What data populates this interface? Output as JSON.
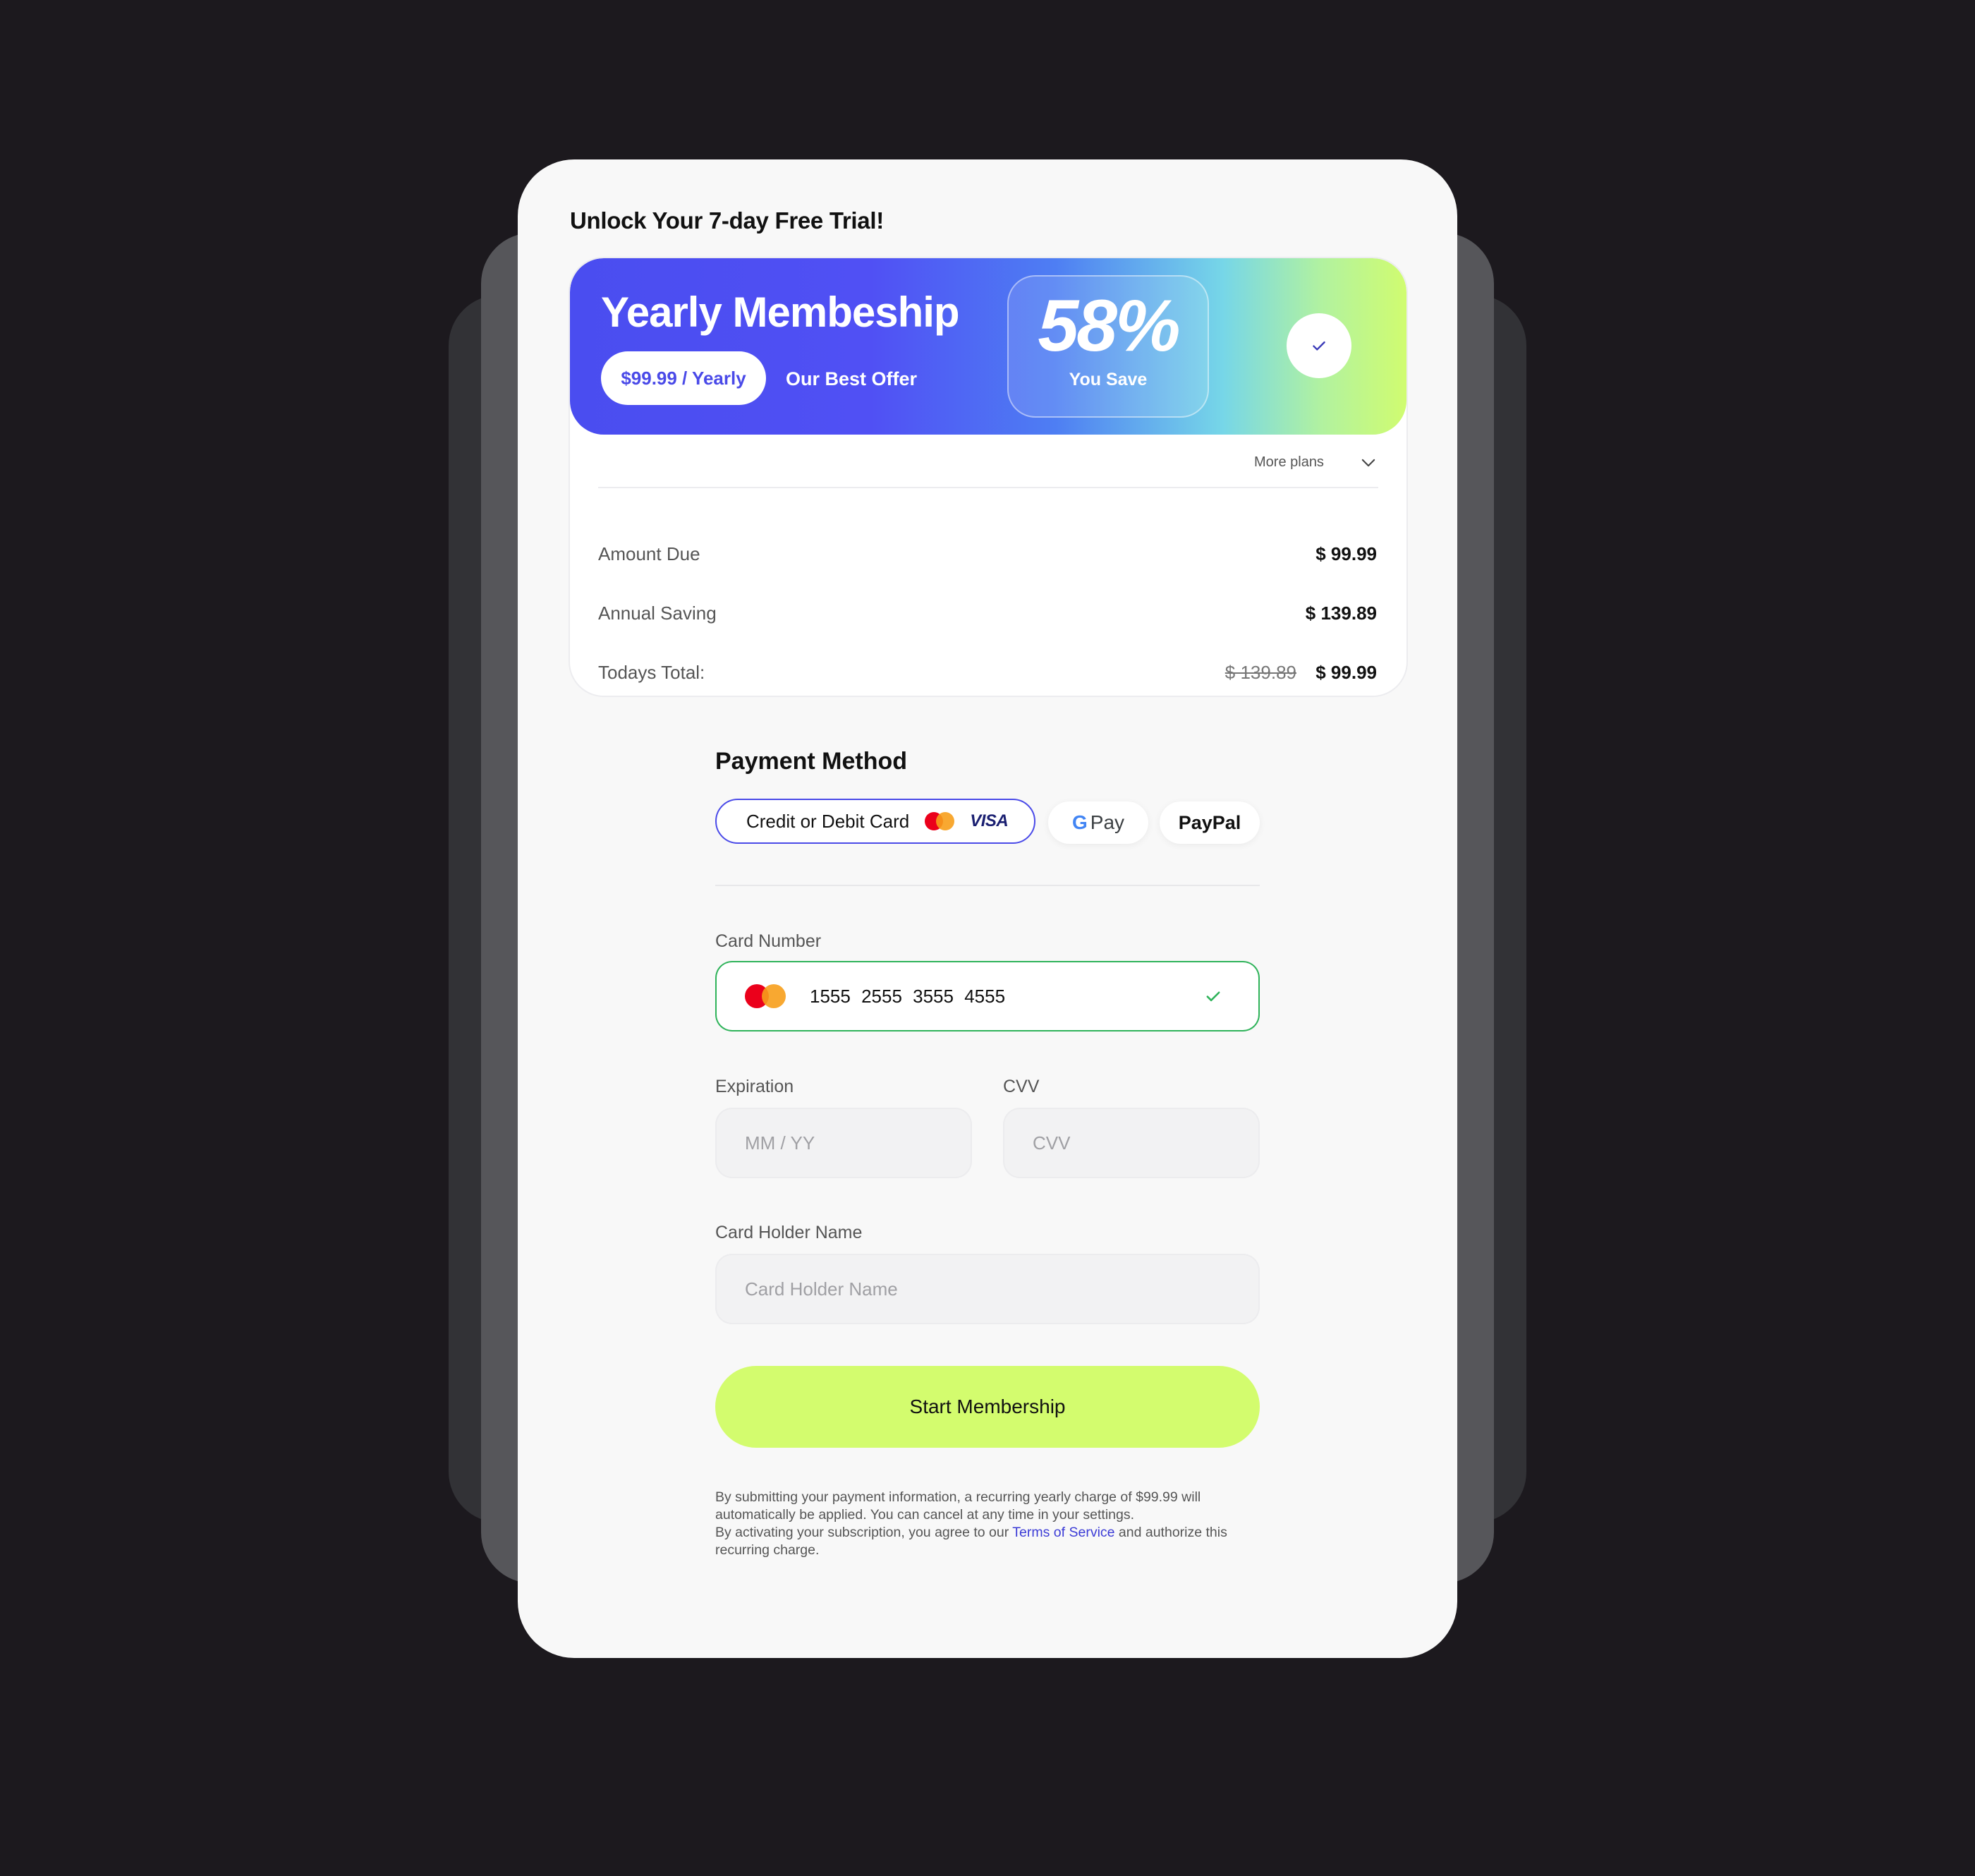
{
  "page": {
    "title": "Unlock Your 7-day Free Trial!"
  },
  "plan": {
    "name": "Yearly Membeship",
    "price": "$99.99 / Yearly",
    "offer_label": "Our Best Offer",
    "save_percent": "58%",
    "save_label": "You Save",
    "selected_icon": "check-icon",
    "more_plans_label": "More plans"
  },
  "summary": {
    "rows": [
      {
        "label": "Amount Due",
        "value": "$ 99.99"
      },
      {
        "label": "Annual Saving",
        "value": "$ 139.89"
      },
      {
        "label": "Todays Total:",
        "value": "$ 99.99",
        "original": "$ 139.89"
      }
    ]
  },
  "payment": {
    "title": "Payment Method",
    "methods": {
      "card": {
        "label": "Credit or Debit Card",
        "visa": "VISA"
      },
      "gpay": {
        "g": "G",
        "label": "Pay"
      },
      "paypal": {
        "label": "PayPal"
      }
    },
    "selected": "card"
  },
  "form": {
    "card_number": {
      "label": "Card Number",
      "value": "1555 2555 3555 4555"
    },
    "expiration": {
      "label": "Expiration",
      "placeholder": "MM / YY"
    },
    "cvv": {
      "label": "CVV",
      "placeholder": "CVV"
    },
    "holder": {
      "label": "Card Holder Name",
      "placeholder": "Card Holder Name"
    },
    "submit_label": "Start Membership"
  },
  "legal": {
    "line1": "By submitting your payment information, a recurring yearly charge of $99.99 will automatically be applied. You can cancel at any time in your settings.",
    "line2_pre": "By activating your subscription, you agree to our ",
    "link": "Terms of Service",
    "line2_post": " and authorize this recurring charge."
  },
  "colors": {
    "accent": "#4a4ae8",
    "button": "#d3fc6e",
    "success": "#2fb35a",
    "background": "#1c191e"
  }
}
